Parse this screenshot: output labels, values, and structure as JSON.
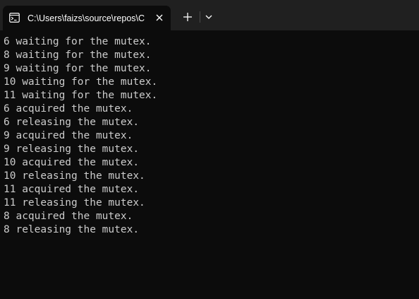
{
  "tab": {
    "title": "C:\\Users\\faizs\\source\\repos\\C",
    "icon": "terminal-icon",
    "close_icon": "close-icon"
  },
  "toolbar": {
    "new_tab_icon": "plus-icon",
    "dropdown_icon": "chevron-down-icon"
  },
  "terminal": {
    "lines": [
      "6 waiting for the mutex.",
      "8 waiting for the mutex.",
      "9 waiting for the mutex.",
      "10 waiting for the mutex.",
      "11 waiting for the mutex.",
      "6 acquired the mutex.",
      "6 releasing the mutex.",
      "9 acquired the mutex.",
      "9 releasing the mutex.",
      "10 acquired the mutex.",
      "10 releasing the mutex.",
      "11 acquired the mutex.",
      "11 releasing the mutex.",
      "8 acquired the mutex.",
      "8 releasing the mutex."
    ]
  },
  "colors": {
    "background": "#0c0c0c",
    "tabbar": "#202020",
    "text": "#cccccc",
    "tab_text": "#ffffff"
  }
}
